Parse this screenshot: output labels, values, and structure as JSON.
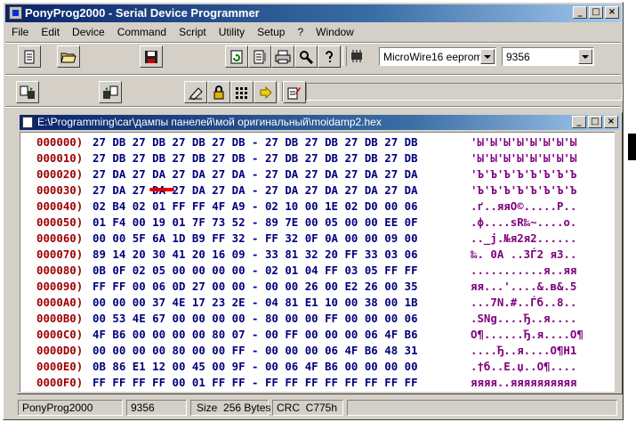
{
  "window": {
    "title": "PonyProg2000 - Serial Device Programmer",
    "buttons": {
      "minimize": "_",
      "maximize": "□",
      "close": "×"
    }
  },
  "menu": [
    "File",
    "Edit",
    "Device",
    "Command",
    "Script",
    "Utility",
    "Setup",
    "?",
    "Window"
  ],
  "toolbar": {
    "device_family": "MicroWire16 eeprom",
    "device_type": "9356"
  },
  "document": {
    "title": "E:\\Programming\\car\\дампы панелей\\мой оригинальный\\moidamp2.hex",
    "rows": [
      {
        "addr": "000000)",
        "bytes": "27 DB 27 DB 27 DB 27 DB - 27 DB 27 DB 27 DB 27 DB",
        "ascii": "'Ы'Ы'Ы'Ы'Ы'Ы'Ы'Ы"
      },
      {
        "addr": "000010)",
        "bytes": "27 DB 27 DB 27 DB 27 DB - 27 DB 27 DB 27 DB 27 DB",
        "ascii": "'Ы'Ы'Ы'Ы'Ы'Ы'Ы'Ы"
      },
      {
        "addr": "000020)",
        "bytes": "27 DA 27 DA 27 DA 27 DA - 27 DA 27 DA 27 DA 27 DA",
        "ascii": "'Ъ'Ъ'Ъ'Ъ'Ъ'Ъ'Ъ'Ъ"
      },
      {
        "addr": "000030)",
        "bytes": "27 DA 27 DA 27 DA 27 DA - 27 DA 27 DA 27 DA 27 DA",
        "ascii": "'Ъ'Ъ'Ъ'Ъ'Ъ'Ъ'Ъ'Ъ"
      },
      {
        "addr": "000040)",
        "bytes": "02 B4 02 01 FF FF 4F A9 - 02 10 00 1E 02 D0 00 06",
        "ascii": ".ґ..яяO©.....Р.."
      },
      {
        "addr": "000050)",
        "bytes": "01 F4 00 19 01 7F 73 52 - 89 7E 00 05 00 00 EE 0F",
        "ascii": ".ф....sR‰~....о."
      },
      {
        "addr": "000060)",
        "bytes": "00 00 5F 6A 1D B9 FF 32 - FF 32 0F 0A 00 00 09 00",
        "ascii": ".._j.№я2я2......"
      },
      {
        "addr": "000070)",
        "bytes": "89 14 20 30 41 20 16 09 - 33 81 32 20 FF 33 03 06",
        "ascii": "‰. 0A ..3Ѓ2 я3.."
      },
      {
        "addr": "000080)",
        "bytes": "0B 0F 02 05 00 00 00 00 - 02 01 04 FF 03 05 FF FF",
        "ascii": "...........я..яя"
      },
      {
        "addr": "000090)",
        "bytes": "FF FF 00 06 0D 27 00 00 - 00 00 26 00 E2 26 00 35",
        "ascii": "яя...'....&.в&.5"
      },
      {
        "addr": "0000A0)",
        "bytes": "00 00 00 37 4E 17 23 2E - 04 81 E1 10 00 38 00 1B",
        "ascii": "...7N.#..Ѓб..8.."
      },
      {
        "addr": "0000B0)",
        "bytes": "00 53 4E 67 00 00 00 00 - 80 00 00 FF 00 00 00 06",
        "ascii": ".SNg....Ђ..я...."
      },
      {
        "addr": "0000C0)",
        "bytes": "4F B6 00 00 00 00 80 07 - 00 FF 00 00 00 06 4F B6",
        "ascii": "O¶......Ђ.я....O¶"
      },
      {
        "addr": "0000D0)",
        "bytes": "00 00 00 00 80 00 00 FF - 00 00 00 06 4F B6 48 31",
        "ascii": "....Ђ..я....O¶H1"
      },
      {
        "addr": "0000E0)",
        "bytes": "0B 86 E1 12 00 45 00 9F - 00 06 4F B6 00 00 00 00",
        "ascii": ".†б..E.џ..O¶...."
      },
      {
        "addr": "0000F0)",
        "bytes": "FF FF FF FF 00 01 FF FF - FF FF FF FF FF FF FF FF",
        "ascii": "яяяя..яяяяяяяяяя"
      }
    ]
  },
  "status": {
    "app": "PonyProg2000",
    "device": "9356",
    "size_label": "Size",
    "size_value": "256 Bytes",
    "crc_label": "CRC",
    "crc_value": "C775h"
  },
  "colors": {
    "address": "#a00000",
    "hex_bytes": "#00007f",
    "ascii": "#800080",
    "title_active": "#0a246a",
    "highlight_mark": "#e00000"
  },
  "icons": [
    "app-icon",
    "new-file-icon",
    "open-folder-icon",
    "save-icon",
    "reload-icon",
    "edit-buffer-icon",
    "print-icon",
    "probe-icon",
    "help-icon",
    "chip-icon",
    "read-icon",
    "write-icon",
    "erase-icon",
    "lock-icon",
    "fuse-icon",
    "program-icon",
    "script-icon",
    "document-icon"
  ]
}
